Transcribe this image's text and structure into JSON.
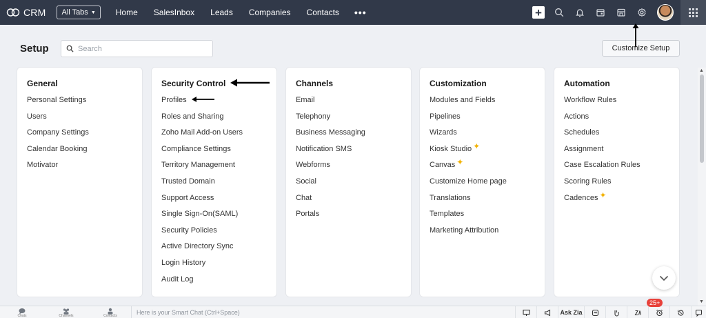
{
  "topbar": {
    "brand": "CRM",
    "all_tabs": "All Tabs",
    "nav": [
      "Home",
      "SalesInbox",
      "Leads",
      "Companies",
      "Contacts"
    ],
    "more": "•••"
  },
  "header": {
    "title": "Setup",
    "search_placeholder": "Search",
    "customize_button": "Customize Setup"
  },
  "cards": [
    {
      "title": "General",
      "items": [
        "Personal Settings",
        "Users",
        "Company Settings",
        "Calendar Booking",
        "Motivator"
      ]
    },
    {
      "title": "Security Control",
      "items": [
        "Profiles",
        "Roles and Sharing",
        "Zoho Mail Add-on Users",
        "Compliance Settings",
        "Territory Management",
        "Trusted Domain",
        "Support Access",
        "Single Sign-On(SAML)",
        "Security Policies",
        "Active Directory Sync",
        "Login History",
        "Audit Log"
      ]
    },
    {
      "title": "Channels",
      "items": [
        "Email",
        "Telephony",
        "Business Messaging",
        "Notification SMS",
        "Webforms",
        "Social",
        "Chat",
        "Portals"
      ]
    },
    {
      "title": "Customization",
      "items": [
        "Modules and Fields",
        "Pipelines",
        "Wizards",
        "Kiosk Studio",
        "Canvas",
        "Customize Home page",
        "Translations",
        "Templates",
        "Marketing Attribution"
      ]
    },
    {
      "title": "Automation",
      "items": [
        "Workflow Rules",
        "Actions",
        "Schedules",
        "Assignment",
        "Case Escalation Rules",
        "Scoring Rules",
        "Cadences"
      ]
    }
  ],
  "bottombar": {
    "items": [
      "Chats",
      "Channels",
      "Contacts"
    ],
    "smart_chat_placeholder": "Here is your Smart Chat (Ctrl+Space)",
    "ask_zia": "Ask Zia",
    "notification_count": "25+"
  },
  "colors": {
    "topbar_bg": "#313949",
    "page_bg": "#eef0f4",
    "sparkle": "#f2b203",
    "badge": "#e8413a"
  }
}
